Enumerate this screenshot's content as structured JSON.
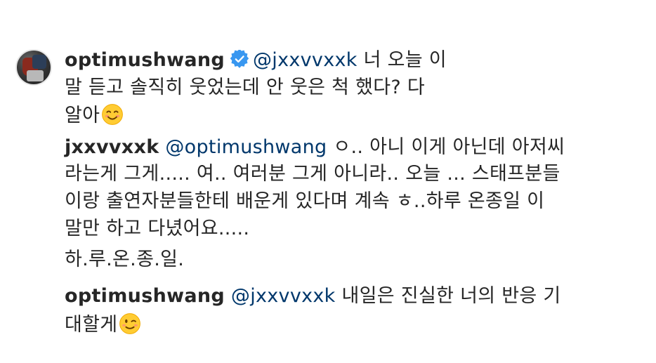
{
  "comments": [
    {
      "username": "optimushwang",
      "verified": true,
      "mention": "@jxxvvxxk",
      "lines": [
        "너 오늘 이",
        "말 듣고 솔직히 웃었는데 안 웃은 척 했다? 다",
        "알아"
      ],
      "emoji": "smiling-face-icon"
    },
    {
      "username": "jxxvvxxk",
      "mention": "@optimushwang",
      "lines": [
        "ㅇ.. 아니 이게 아닌데 아저씨",
        "라는게 그게..... 여.. 여러분 그게 아니라.. 오늘 ... 스태프분들",
        "이랑 출연자분들한테 배운게 있다며 계속 ㅎ..하루 온종일 이",
        "말만 하고 다녔어요.....",
        "하.루.온.종.일."
      ]
    },
    {
      "username": "optimushwang",
      "mention": "@jxxvvxxk",
      "lines": [
        "내일은 진실한 너의 반응 기",
        "대할게"
      ],
      "emoji": "winking-face-icon"
    }
  ],
  "colors": {
    "text": "#262626",
    "mention": "#00376b",
    "verified": "#3897f0"
  }
}
